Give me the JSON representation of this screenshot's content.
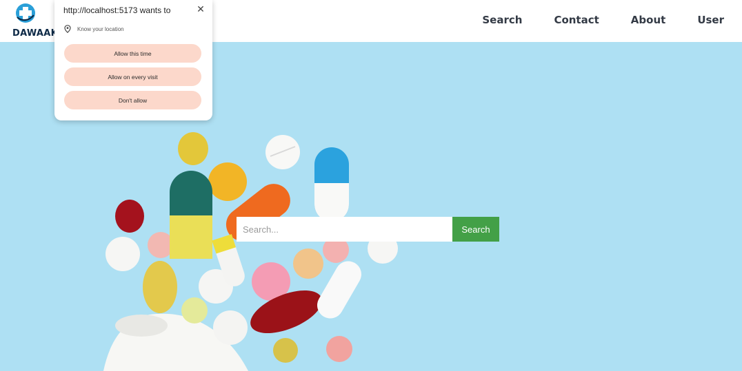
{
  "header": {
    "logo_text": "DAWAAK",
    "nav": [
      "Search",
      "Contact",
      "About",
      "User"
    ]
  },
  "hero": {
    "search_placeholder": "Search...",
    "search_button": "Search"
  },
  "permission_prompt": {
    "title": "http://localhost:5173 wants to",
    "close_glyph": "✕",
    "request": "Know your location",
    "buttons": [
      "Allow this time",
      "Allow on every visit",
      "Don't allow"
    ]
  },
  "colors": {
    "hero_background": "#aee0f3",
    "search_button": "#43a047",
    "prompt_button": "#fcd8cb",
    "logo_blue": "#2a9fd8"
  }
}
